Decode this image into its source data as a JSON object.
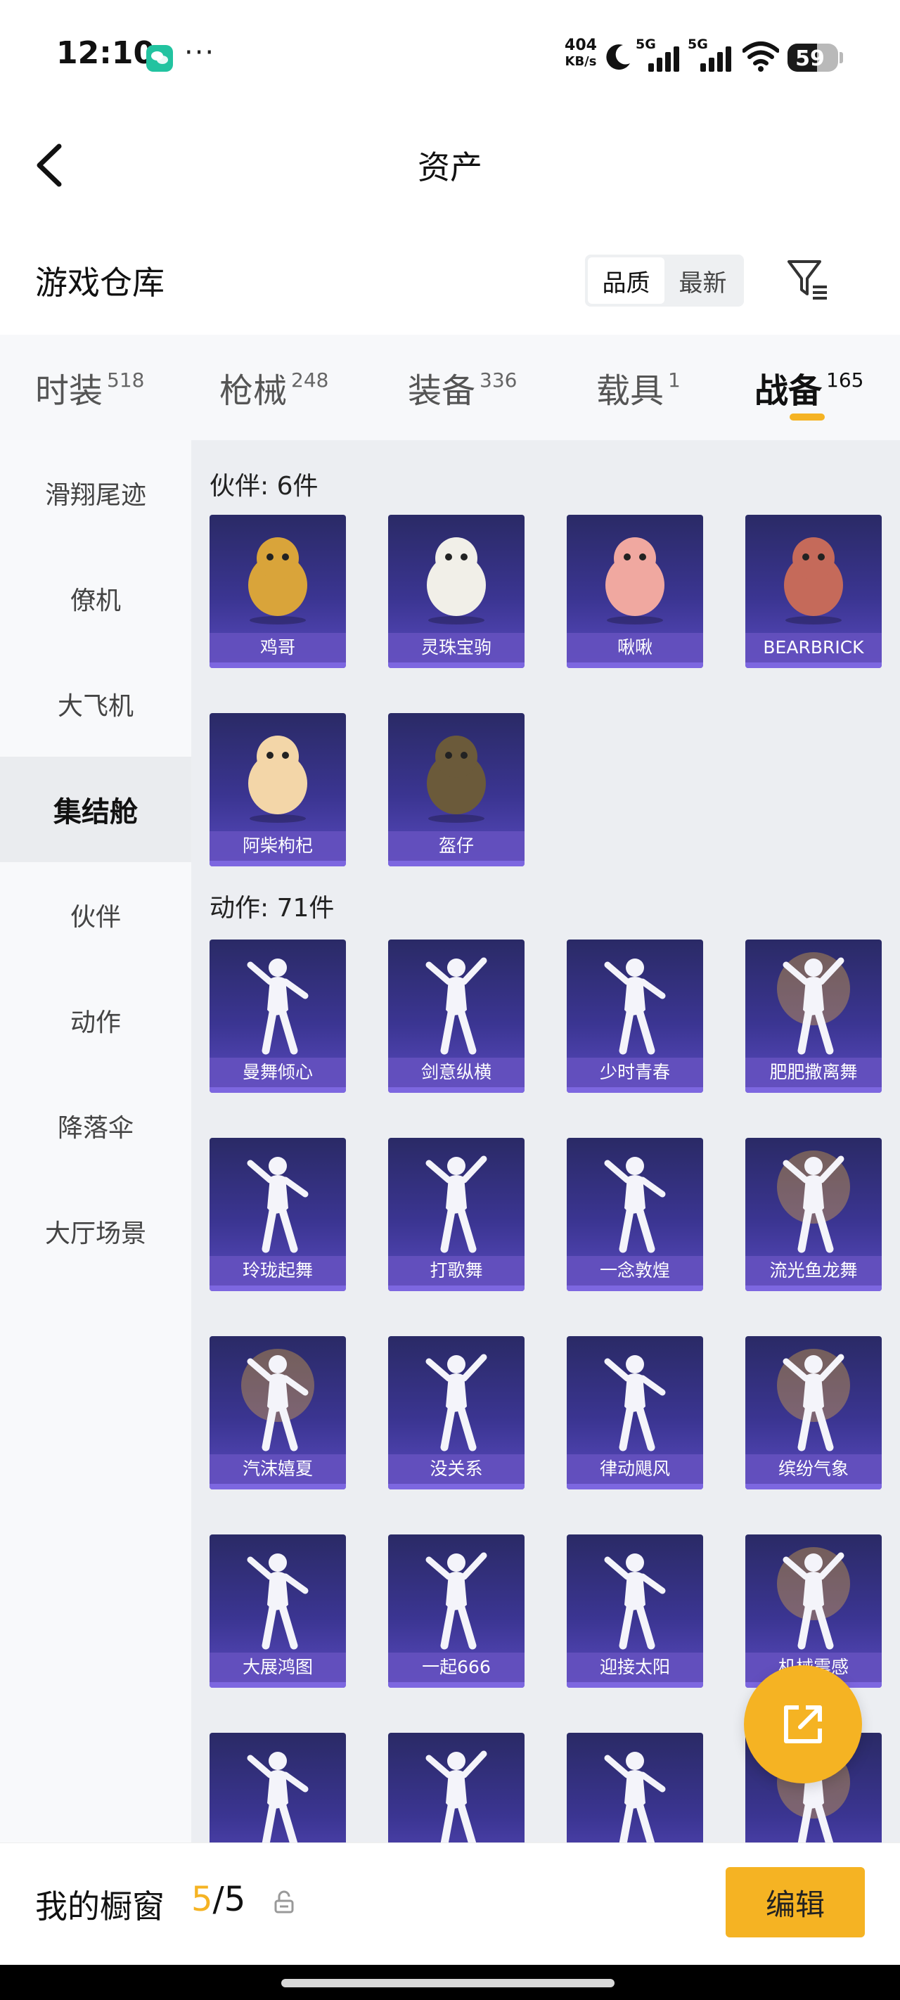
{
  "status_bar": {
    "time": "12:10",
    "more": "···",
    "net_speed_value": "404",
    "net_speed_unit": "KB/s",
    "signal_1": "5G",
    "signal_2": "5G",
    "battery": "59",
    "battery_level": 0.59
  },
  "nav": {
    "title": "资产"
  },
  "header": {
    "title": "游戏仓库",
    "sort_options": [
      "品质",
      "最新"
    ],
    "sort_active": "品质"
  },
  "tabs": [
    {
      "label": "时装",
      "count": "518"
    },
    {
      "label": "枪械",
      "count": "248"
    },
    {
      "label": "装备",
      "count": "336"
    },
    {
      "label": "载具",
      "count": "1"
    },
    {
      "label": "战备",
      "count": "165",
      "active": true
    }
  ],
  "sidebar": {
    "items": [
      "滑翔尾迹",
      "僚机",
      "大飞机",
      "集结舱",
      "伙伴",
      "动作",
      "降落伞",
      "大厅场景"
    ],
    "active": "集结舱"
  },
  "groups": [
    {
      "title": "伙伴: 6件",
      "items": [
        "鸡哥",
        "灵珠宝驹",
        "啾啾",
        "BEARBRICK",
        "阿柴枸杞",
        "盔仔"
      ]
    },
    {
      "title": "动作: 71件",
      "items": [
        "曼舞倾心",
        "剑意纵横",
        "少时青春",
        "肥肥撒离舞",
        "玲珑起舞",
        "打歌舞",
        "一念敦煌",
        "流光鱼龙舞",
        "汽沫嬉夏",
        "没关系",
        "律动飓风",
        "缤纷气象",
        "大展鸿图",
        "一起666",
        "迎接太阳",
        "机械震感",
        "",
        "",
        "",
        ""
      ]
    }
  ],
  "bottom": {
    "label": "我的橱窗",
    "current": "5",
    "total": "5",
    "edit": "编辑"
  }
}
